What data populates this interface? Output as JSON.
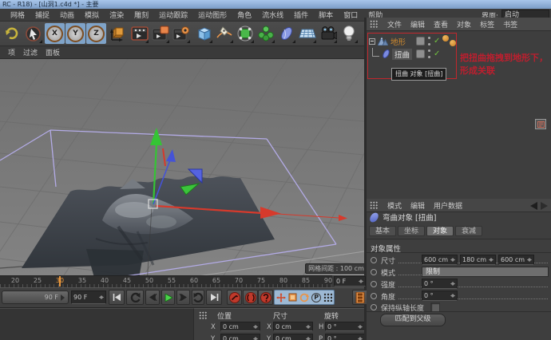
{
  "colors": {
    "accent_orange": "#d98e2e",
    "annotation_red": "#bf1e2e",
    "check_green": "#72c23e",
    "cage_purple": "#b3abe6",
    "axis_red": "#d63a2c",
    "axis_green": "#35c435",
    "axis_blue": "#4553d6",
    "key_highlight_blue": "#9db9d4"
  },
  "title_bar": {
    "title": "RC - R18) - [山洞1.c4d *] - 主要"
  },
  "menu_bar": {
    "items": [
      "网格",
      "捕捉",
      "动画",
      "模拟",
      "渲染",
      "雕刻",
      "运动跟踪",
      "运动图形",
      "角色",
      "流水线",
      "插件",
      "脚本",
      "窗口",
      "帮助"
    ],
    "interface_label": "界面:",
    "interface_value": "启动"
  },
  "toolbar": {
    "axis_x": "X",
    "axis_y": "Y",
    "axis_z": "Z"
  },
  "viewport": {
    "menu_items": [
      "项",
      "过滤",
      "面板"
    ],
    "grid_spacing": "网格间距 : 100 cm"
  },
  "timeline": {
    "ticks": [
      "20",
      "25",
      "30",
      "35",
      "40",
      "45",
      "50",
      "55",
      "60",
      "65",
      "70",
      "75",
      "80",
      "85",
      "90"
    ],
    "current_frame": "30",
    "range_label": "90 F",
    "frame_field": "90 F",
    "offset_field": "0 F",
    "parameter_letter": "P"
  },
  "coordinates": {
    "headers": [
      "位置",
      "尺寸",
      "旋转"
    ],
    "row1": {
      "l1": "X",
      "v1": "0 cm",
      "l2": "X",
      "v2": "0 cm",
      "l3": "H",
      "v3": "0 °"
    },
    "row2": {
      "l1": "Y",
      "v1": "0 cm",
      "l2": "Y",
      "v2": "0 cm",
      "l3": "P",
      "v3": "0 °"
    }
  },
  "object_manager": {
    "menu": [
      "文件",
      "编辑",
      "查看",
      "对象",
      "标签",
      "书签"
    ],
    "objects": [
      {
        "name": "地形"
      },
      {
        "name": "扭曲"
      }
    ],
    "tooltip": "扭曲 对象 [扭曲]"
  },
  "annotation": {
    "line1": "把扭曲拖拽到地形下，",
    "line2": "形成关联"
  },
  "attribute_manager": {
    "menu": [
      "模式",
      "编辑",
      "用户数据"
    ],
    "object_title": "弯曲对象 [扭曲]",
    "tabs": [
      "基本",
      "坐标",
      "对象",
      "衰减"
    ],
    "section_title": "对象属性",
    "size_label": "尺寸",
    "size_values": [
      "600 cm",
      "180 cm",
      "600 cm"
    ],
    "mode_label": "模式",
    "mode_value": "限制",
    "strength_label": "强度",
    "strength_value": "0 °",
    "angle_label": "角度",
    "angle_value": "0 °",
    "keep_length_label": "保持纵轴长度",
    "fit_parent_button": "匹配到父级"
  }
}
